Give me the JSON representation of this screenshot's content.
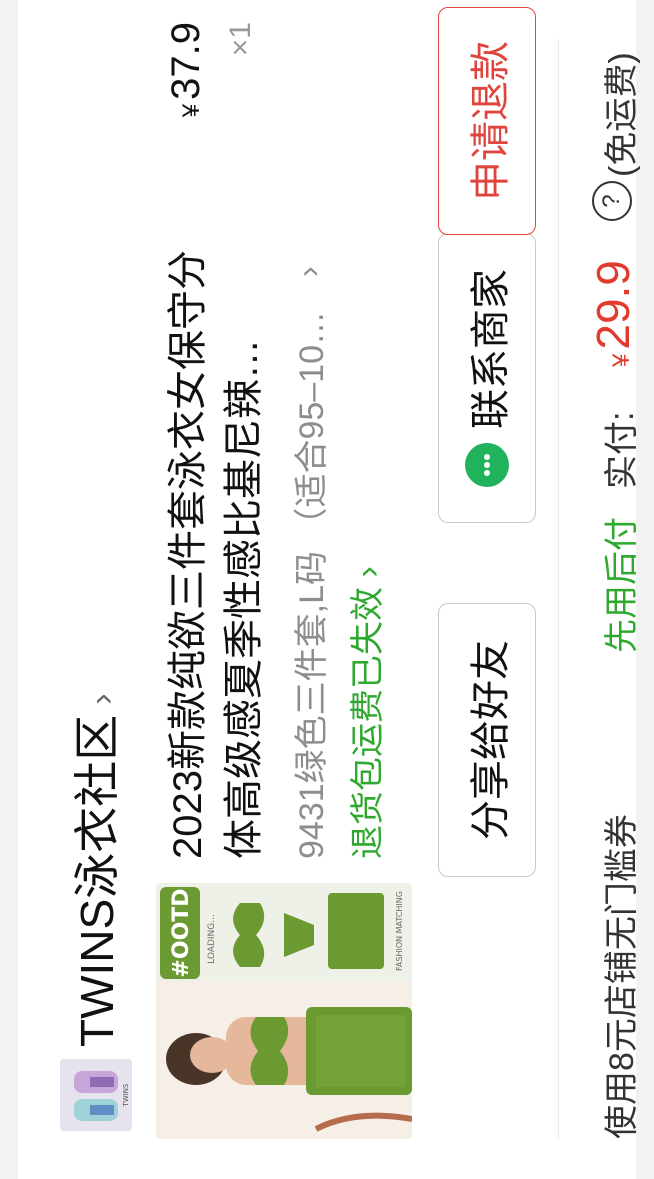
{
  "shop": {
    "name": "TWINS泳衣社区",
    "chevron": "›",
    "logo_text": "TWINS"
  },
  "product": {
    "title": "2023新款纯欲三件套泳衣女保守分体高级感夏季性感比基尼辣…",
    "price_symbol": "¥",
    "price": "37.9",
    "quantity": "×1",
    "spec": "9431绿色三件套,L码 （适合95–10…",
    "spec_arrow": "›",
    "note": "退货包运费已失效",
    "note_arrow": "›",
    "image_badge": "#OOTD",
    "image_caption": "LOADING...",
    "image_subcaption": "FASHION MATCHING"
  },
  "actions": {
    "share": "分享给好友",
    "contact": "联系商家",
    "refund": "申请退款"
  },
  "footer": {
    "coupon": "使用8元店铺无门槛券",
    "pay_later": "先用后付",
    "paid_label": "实付:",
    "paid_symbol": "¥",
    "paid_amount": "29.9",
    "help": "?",
    "shipping": "(免运费)"
  },
  "colors": {
    "accent_red": "#e23a2d",
    "accent_green": "#2fa82f",
    "wechat_green": "#21b35b",
    "product_green": "#6c9a32"
  }
}
